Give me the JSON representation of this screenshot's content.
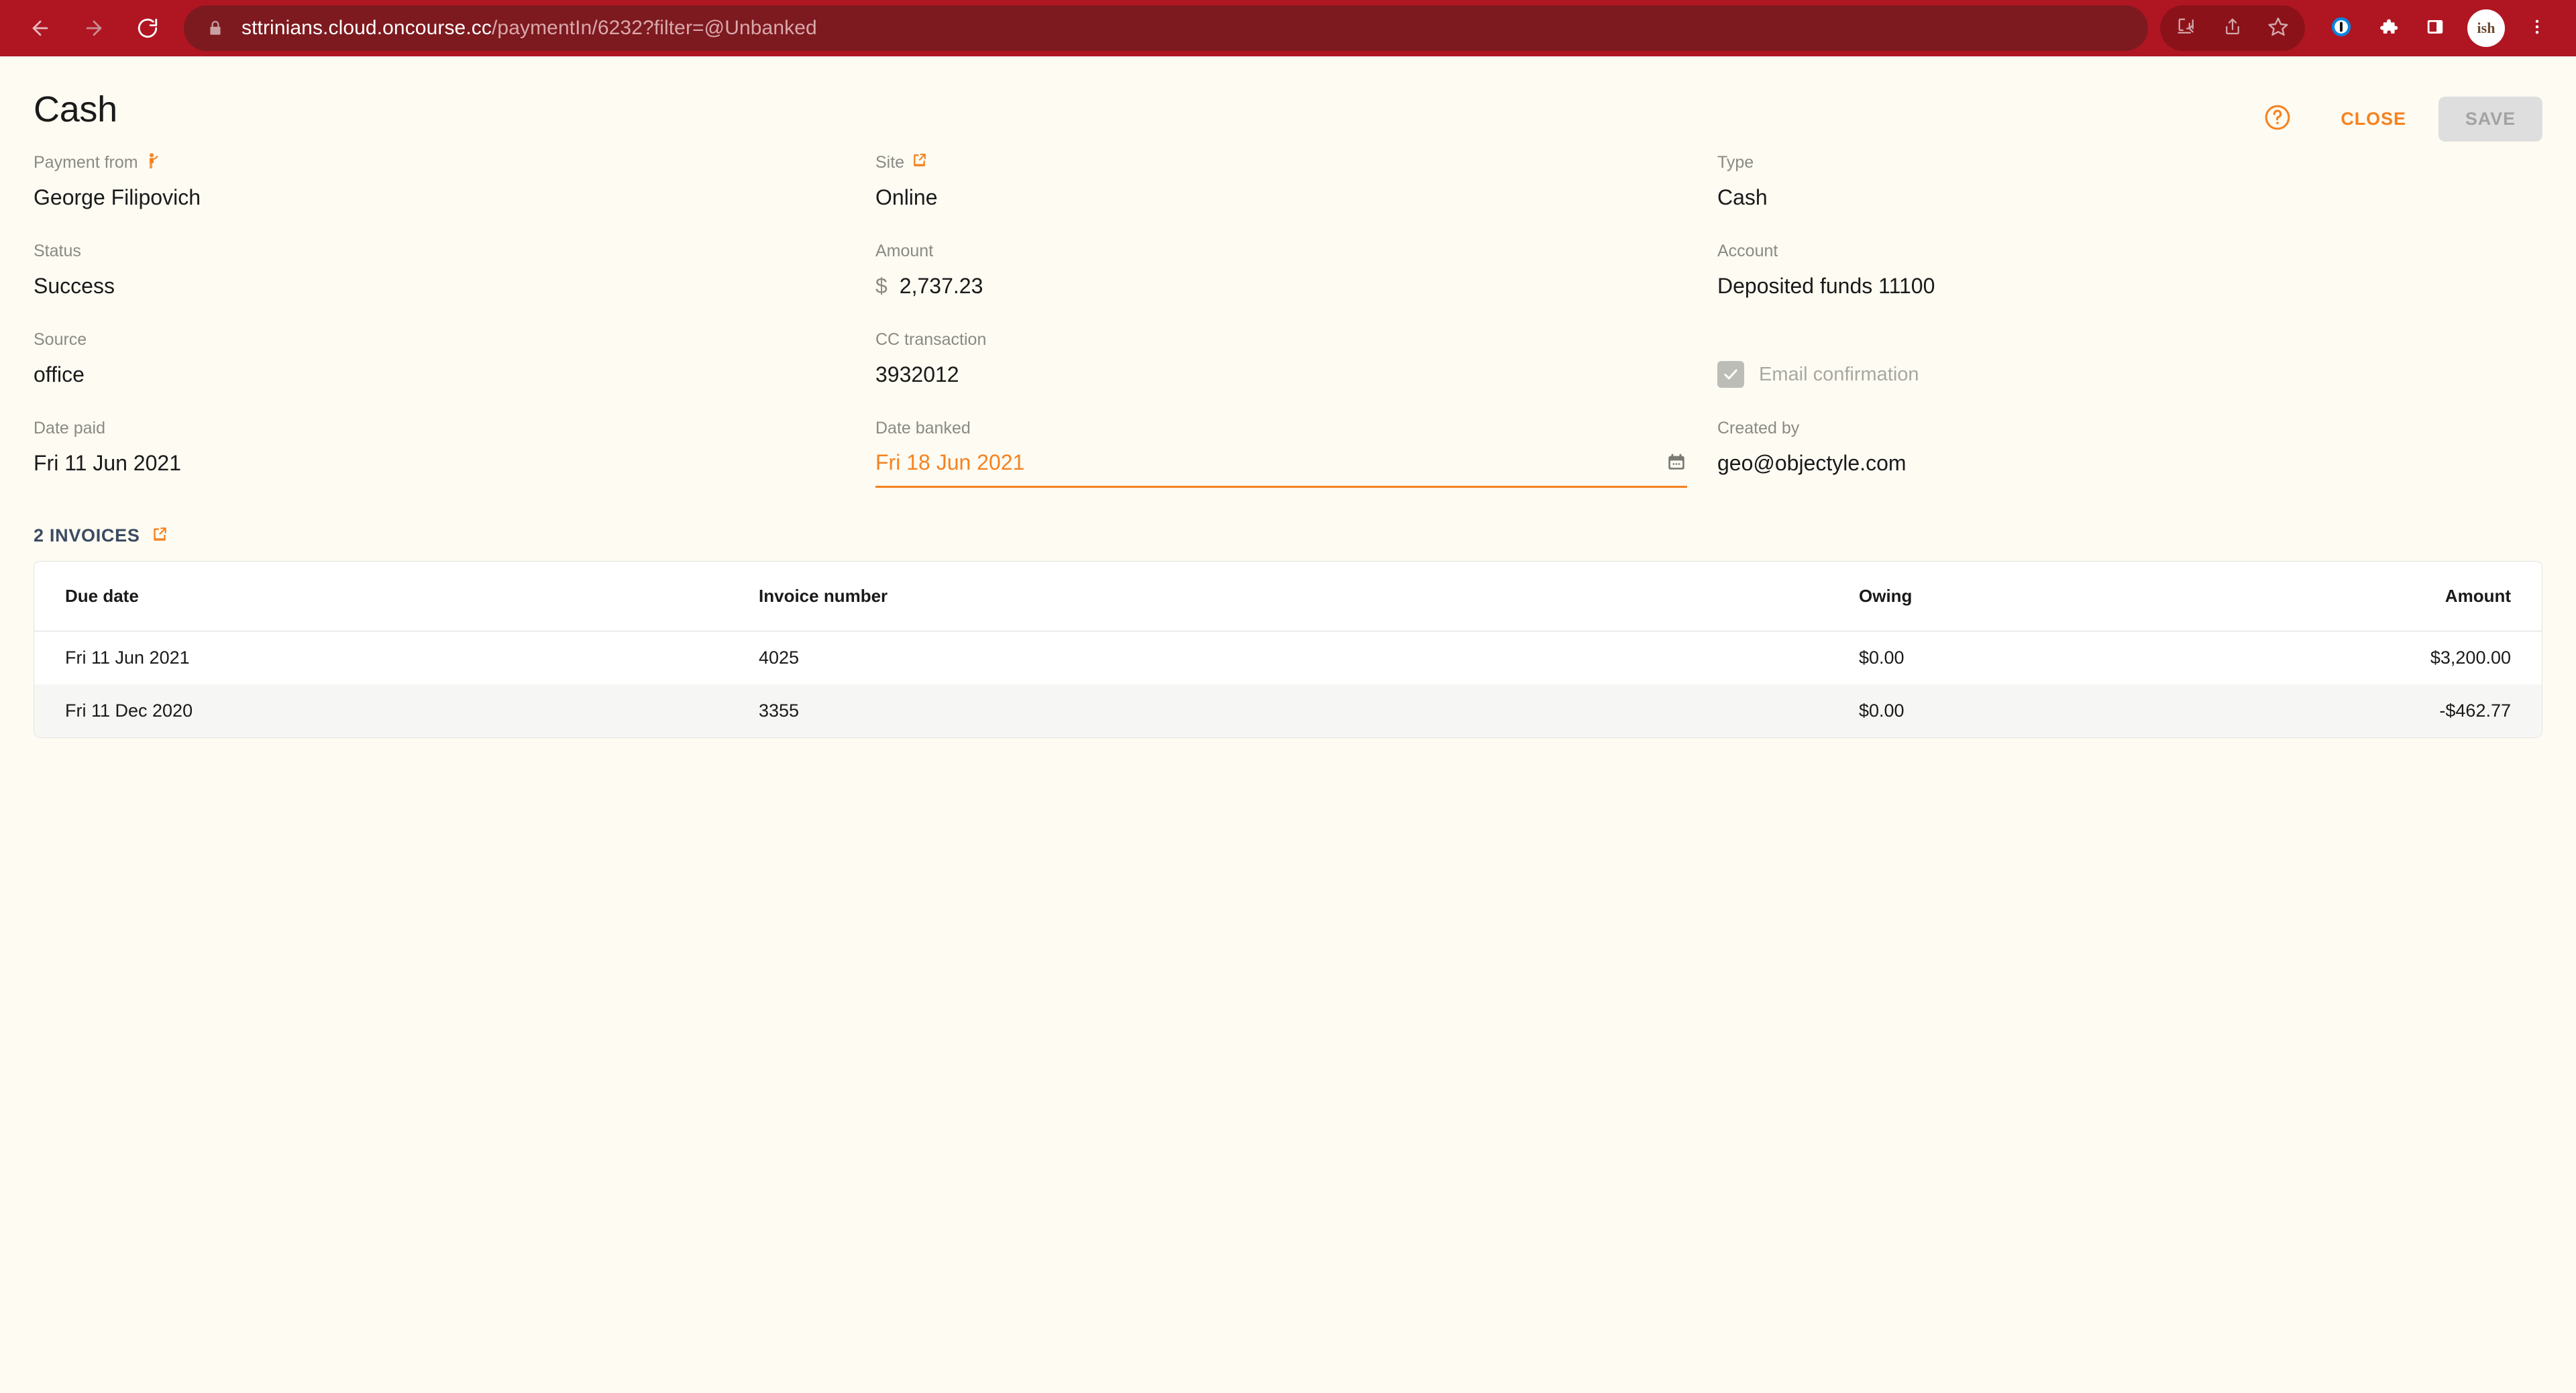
{
  "browser": {
    "url_host": "sttrinians.cloud.oncourse.cc",
    "url_path": "/paymentIn/6232?filter=@Unbanked",
    "back_icon": "back-arrow-icon",
    "forward_icon": "forward-arrow-icon",
    "reload_icon": "reload-icon",
    "lock_icon": "lock-icon",
    "install_icon": "install-app-icon",
    "share_icon": "share-icon",
    "bookmark_icon": "bookmark-star-icon",
    "password_icon": "one-password-icon",
    "extensions_icon": "extensions-puzzle-icon",
    "side_panel_icon": "side-panel-icon",
    "avatar_label": "ish",
    "menu_icon": "three-dot-menu-icon"
  },
  "header": {
    "title": "Cash",
    "help_label": "?",
    "close_label": "CLOSE",
    "save_label": "SAVE"
  },
  "colors": {
    "accent_orange": "#F58220",
    "chrome_red": "#AF1622",
    "omnibox_red": "#7D1A1F",
    "page_bg": "#FDFBF2",
    "link_navy": "#3B4A63",
    "label_gray": "#8A8A85",
    "disabled_gray": "#A8A8A3"
  },
  "fields": {
    "column1": [
      {
        "label": "Payment from",
        "value": "George Filipovich",
        "icon": "person-icon"
      },
      {
        "label": "Status",
        "value": "Success",
        "icon": null
      },
      {
        "label": "Source",
        "value": "office",
        "icon": null
      },
      {
        "label": "Date paid",
        "value": "Fri 11 Jun 2021",
        "icon": null
      }
    ],
    "column2": [
      {
        "label": "Site",
        "value": "Online",
        "icon": "external-link-icon"
      },
      {
        "label": "Amount",
        "value": "2,737.23",
        "currency": "$",
        "icon": null
      },
      {
        "label": "CC transaction",
        "value": "3932012",
        "icon": null
      },
      {
        "label": "Date banked",
        "value": "Fri 18 Jun 2021",
        "icon": "calendar-icon",
        "active": true
      }
    ],
    "column3": [
      {
        "label": "Type",
        "value": "Cash",
        "icon": null
      },
      {
        "label": "Account",
        "value": "Deposited funds 11100",
        "icon": null
      },
      {
        "label": "Email confirmation",
        "checked": true,
        "disabled": true,
        "icon": "checkbox-checked-icon"
      },
      {
        "label": "Created by",
        "value": "geo@objectyle.com",
        "icon": null
      }
    ]
  },
  "invoices": {
    "link_label": "2 INVOICES",
    "link_icon": "external-link-icon",
    "columns": [
      "Due date",
      "Invoice number",
      "Owing",
      "Amount"
    ],
    "rows": [
      {
        "due_date": "Fri 11 Jun 2021",
        "invoice_number": "4025",
        "owing": "$0.00",
        "amount": "$3,200.00"
      },
      {
        "due_date": "Fri 11 Dec 2020",
        "invoice_number": "3355",
        "owing": "$0.00",
        "amount": "-$462.77"
      }
    ]
  }
}
